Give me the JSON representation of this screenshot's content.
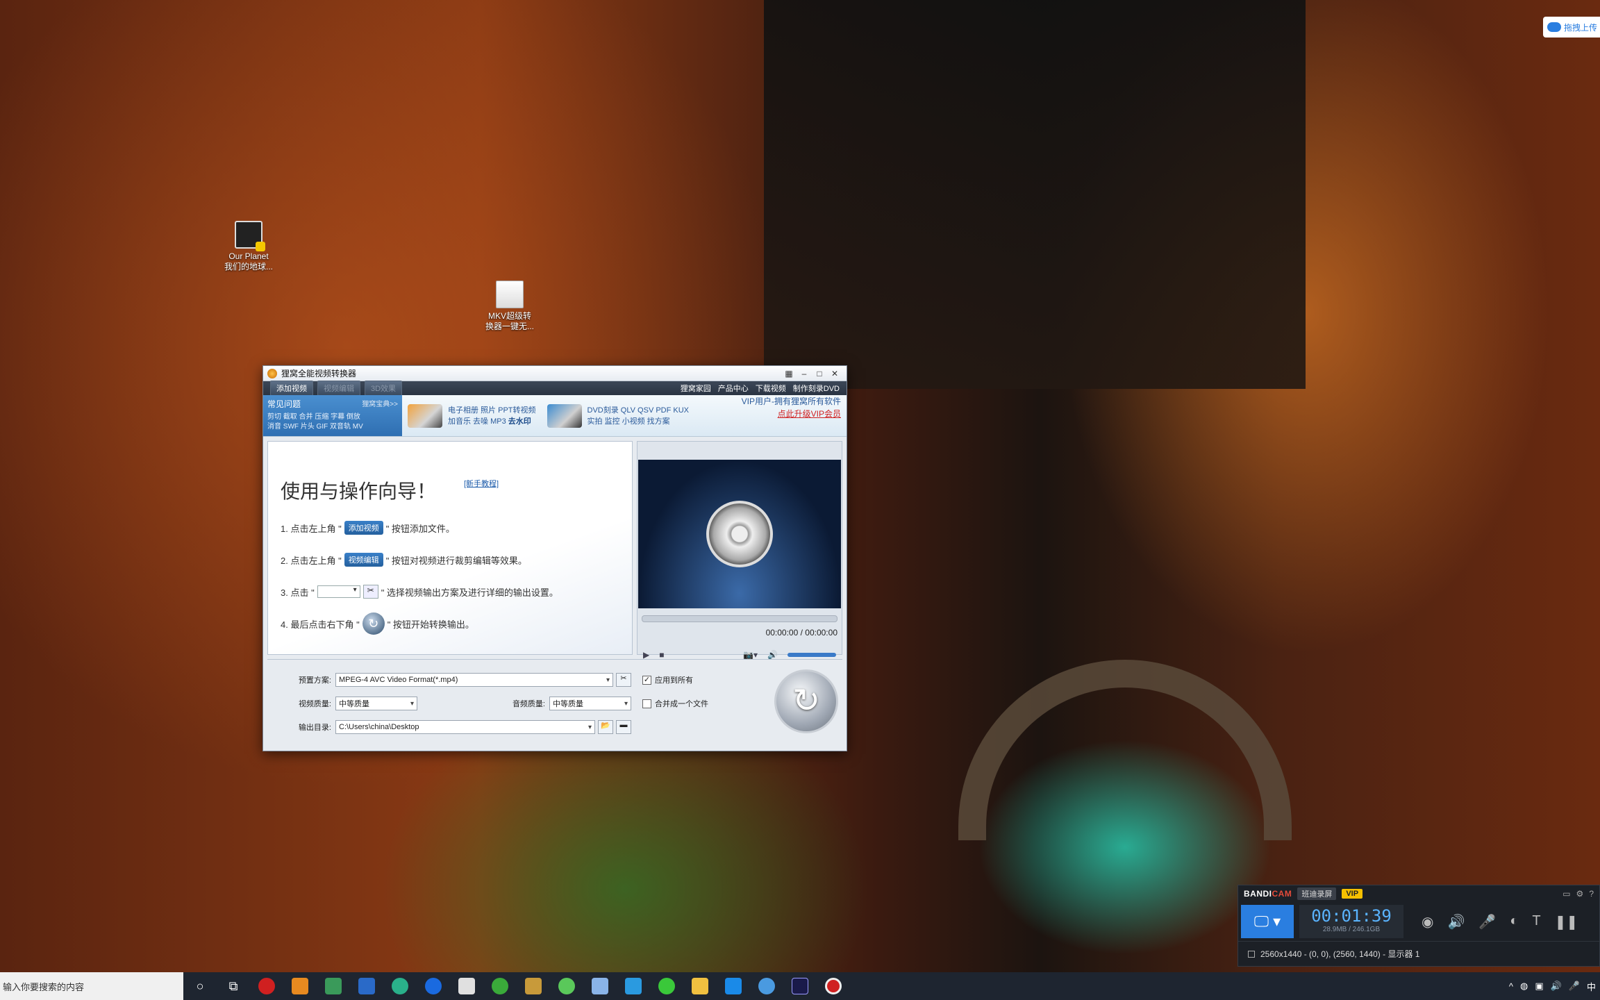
{
  "desktop": {
    "icons": [
      {
        "label1": "Our Planet",
        "label2": "我们的地球..."
      },
      {
        "label1": "MKV超级转",
        "label2": "换器一键无..."
      }
    ],
    "cloud_label": "拖拽上传"
  },
  "window": {
    "title": "狸窝全能视频转换器",
    "toolbar": {
      "add_video": "添加视频",
      "video_edit": "视频编辑",
      "effect": "3D效果",
      "links": [
        "狸窝家园",
        "产品中心",
        "下载视频",
        "制作刻录DVD"
      ]
    },
    "adbar": {
      "faq_title": "常见问题",
      "faq_more": "狸窝宝典>>",
      "faq_line1": "剪切 截取 合并 压缩 字幕 倒放",
      "faq_line2": "消音 SWF 片头 GIF 双音轨 MV",
      "ad1_line1": "电子相册 照片 PPT转视频",
      "ad1_line2_a": "加音乐 去噪 MP3",
      "ad1_line2_b": "去水印",
      "ad2_line1": "DVD刻录 QLV QSV PDF KUX",
      "ad2_line2": "实拍 监控 小视频 找方案",
      "vip_line1": "VIP用户-拥有狸窝所有软件",
      "vip_line2": "点此升级VIP会员"
    },
    "guide": {
      "title": "使用与操作向导！",
      "tutorial": "[新手教程]",
      "step1_pre": "1. 点击左上角 \"",
      "step1_chip": "添加视频",
      "step1_post": "\" 按钮添加文件。",
      "step2_pre": "2. 点击左上角 \"",
      "step2_chip": "视频编辑",
      "step2_post": "\" 按钮对视频进行裁剪编辑等效果。",
      "step3_pre": "3. 点击 \"",
      "step3_post": "\" 选择视频输出方案及进行详细的输出设置。",
      "step4_pre": "4. 最后点击右下角 \"",
      "step4_post": "\" 按钮开始转换输出。"
    },
    "player": {
      "time": "00:00:00 / 00:00:00"
    },
    "settings": {
      "preset_label": "预置方案:",
      "preset_value": "MPEG-4 AVC Video Format(*.mp4)",
      "apply_all": "应用到所有",
      "apply_all_checked": true,
      "video_quality_label": "视频质量:",
      "video_quality_value": "中等质量",
      "audio_quality_label": "音频质量:",
      "audio_quality_value": "中等质量",
      "merge_label": "合并成一个文件",
      "merge_checked": false,
      "output_label": "输出目录:",
      "output_value": "C:\\Users\\china\\Desktop"
    }
  },
  "bandicam": {
    "brand_a": "BANDI",
    "brand_b": "CAM",
    "tag": "班迪录屏",
    "vip": "VIP",
    "timer": "00:01:39",
    "size": "28.9MB / 246.1GB",
    "status": "2560x1440 - (0, 0), (2560, 1440) - 显示器 1"
  },
  "taskbar": {
    "search_placeholder": "输入你要搜索的内容",
    "ime": "中"
  }
}
